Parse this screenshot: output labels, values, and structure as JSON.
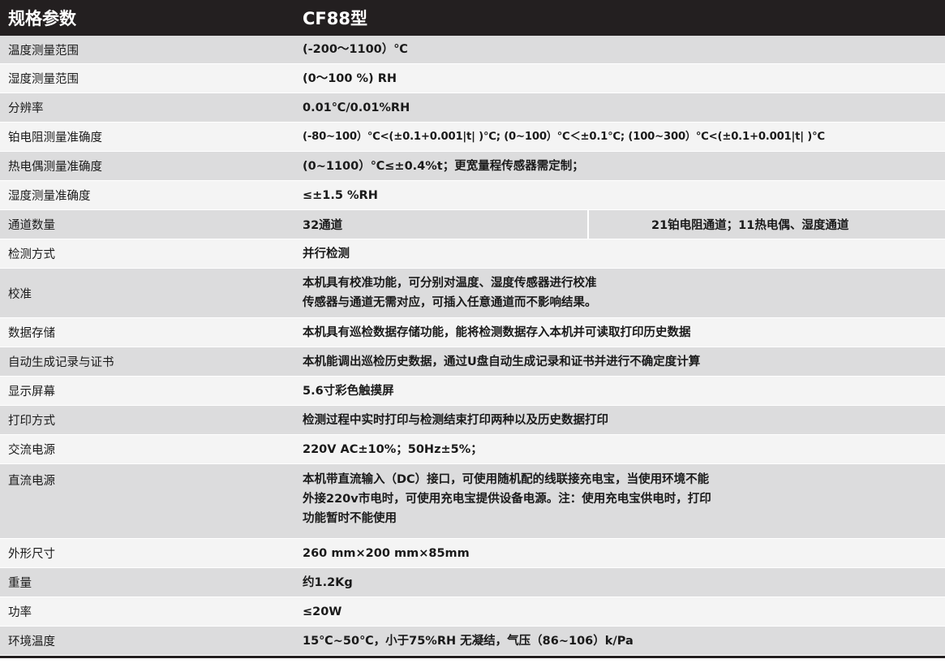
{
  "header": {
    "label": "规格参数",
    "model": "CF88型"
  },
  "colors": {
    "header_bg": "#231f20",
    "row_odd": "#dcdcdd",
    "row_even": "#f4f4f4"
  },
  "rows": [
    {
      "label": "温度测量范围",
      "value": "(-200～1100）℃"
    },
    {
      "label": "湿度测量范围",
      "value": "(0～100 %) RH"
    },
    {
      "label": "分辨率",
      "value": "0.01℃/0.01%RH"
    },
    {
      "label": "铂电阻测量准确度",
      "value": "(-80~100）℃<(±0.1+0.001|t| )℃; (0~100）℃＜±0.1℃; (100~300）℃<(±0.1+0.001|t| )℃"
    },
    {
      "label": "热电偶测量准确度",
      "value": "(0~1100）℃≤±0.4%t；更宽量程传感器需定制；"
    },
    {
      "label": "湿度测量准确度",
      "value": "≤±1.5 %RH"
    },
    {
      "label": "通道数量",
      "value_a": "32通道",
      "value_b": "21铂电阻通道；11热电偶、湿度通道"
    },
    {
      "label": "检测方式",
      "value": "并行检测"
    },
    {
      "label": "校准",
      "lines": [
        "本机具有校准功能，可分别对温度、湿度传感器进行校准",
        "传感器与通道无需对应，可插入任意通道而不影响结果。"
      ]
    },
    {
      "label": "数据存储",
      "value": "本机具有巡检数据存储功能，能将检测数据存入本机并可读取打印历史数据"
    },
    {
      "label": "自动生成记录与证书",
      "value": "本机能调出巡检历史数据，通过U盘自动生成记录和证书并进行不确定度计算"
    },
    {
      "label": "显示屏幕",
      "value": "5.6寸彩色触摸屏"
    },
    {
      "label": "打印方式",
      "value": "检测过程中实时打印与检测结束打印两种以及历史数据打印"
    },
    {
      "label": "交流电源",
      "value": "220V AC±10%；50Hz±5%；"
    },
    {
      "label": "直流电源",
      "lines": [
        "本机带直流输入（DC）接口，可使用随机配的线联接充电宝，当使用环境不能",
        "外接220v市电时，可使用充电宝提供设备电源。注：使用充电宝供电时，打印",
        "功能暂时不能使用"
      ]
    },
    {
      "label": "外形尺寸",
      "value": "260 mm×200 mm×85mm"
    },
    {
      "label": "重量",
      "value": "约1.2Kg"
    },
    {
      "label": "功率",
      "value": "≤20W"
    },
    {
      "label": "环境温度",
      "value": "15℃~50℃，小于75%RH 无凝结，气压（86~106）k/Pa"
    }
  ]
}
